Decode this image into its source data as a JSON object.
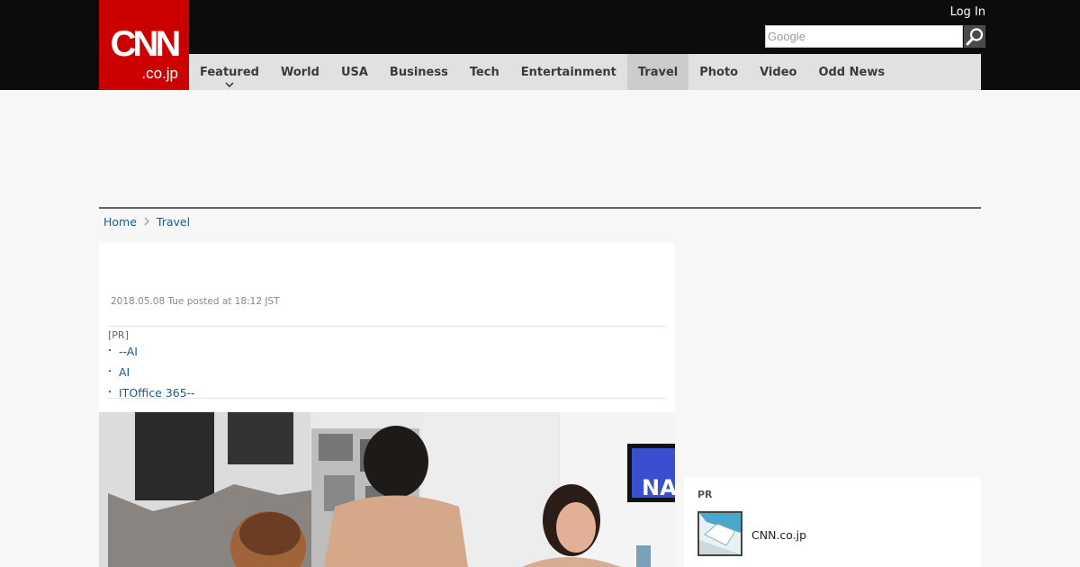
{
  "header": {
    "logo_text_top": "CNN",
    "logo_text_bottom": ".co.jp",
    "login_label": "Log In",
    "search": {
      "placeholder": "Google"
    },
    "brand_color": "#cc0000"
  },
  "nav": {
    "items": [
      {
        "label": "Featured"
      },
      {
        "label": "World"
      },
      {
        "label": "USA"
      },
      {
        "label": "Business"
      },
      {
        "label": "Tech"
      },
      {
        "label": "Entertainment"
      },
      {
        "label": "Travel"
      },
      {
        "label": "Photo"
      },
      {
        "label": "Video"
      },
      {
        "label": "Odd News"
      }
    ],
    "active": "Travel"
  },
  "breadcrumb": {
    "home": "Home",
    "current": "Travel"
  },
  "article": {
    "posted": "2018.05.08 Tue posted at 18:12 JST",
    "pr_tag": "[PR]",
    "pr_links": [
      {
        "label": "--AI"
      },
      {
        "label": "AI"
      },
      {
        "label": "ITOffice 365--"
      }
    ],
    "photo_text": "NA"
  },
  "sidebar": {
    "pr_title": "PR",
    "pr_link": "CNN.co.jp"
  },
  "icons": {
    "search": "magnifier-icon",
    "breadcrumb_separator": "chevron-right-icon",
    "nav_dropdown": "chevron-down-icon"
  }
}
